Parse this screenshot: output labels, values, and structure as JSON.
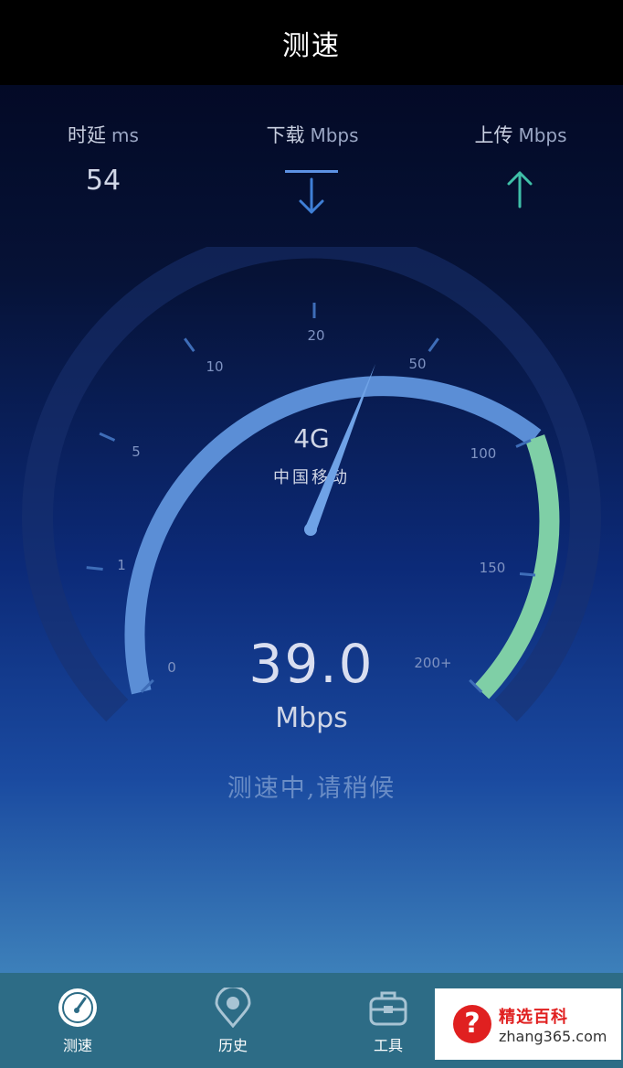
{
  "header": {
    "title": "测速"
  },
  "metrics": {
    "latency": {
      "label": "时延",
      "unit": "ms",
      "value": "54"
    },
    "download": {
      "label": "下载",
      "unit": "Mbps"
    },
    "upload": {
      "label": "上传",
      "unit": "Mbps"
    }
  },
  "gauge": {
    "scale_labels": [
      "0",
      "1",
      "5",
      "10",
      "20",
      "50",
      "100",
      "150",
      "200+"
    ],
    "network_type": "4G",
    "carrier": "中国移动",
    "speed_value": "39.0",
    "speed_unit": "Mbps",
    "colors": {
      "track": "#5b8ed6",
      "high_zone": "#7fcfa6",
      "needle": "#6fa2e6"
    }
  },
  "status_text": "测速中,请稍候",
  "bottom_nav": {
    "items": [
      {
        "label": "测速",
        "icon": "speedometer-icon",
        "active": true
      },
      {
        "label": "历史",
        "icon": "location-pin-icon"
      },
      {
        "label": "工具",
        "icon": "toolbox-icon"
      }
    ]
  },
  "watermark": {
    "title": "精选百科",
    "url": "zhang365.com",
    "badge": "?"
  }
}
